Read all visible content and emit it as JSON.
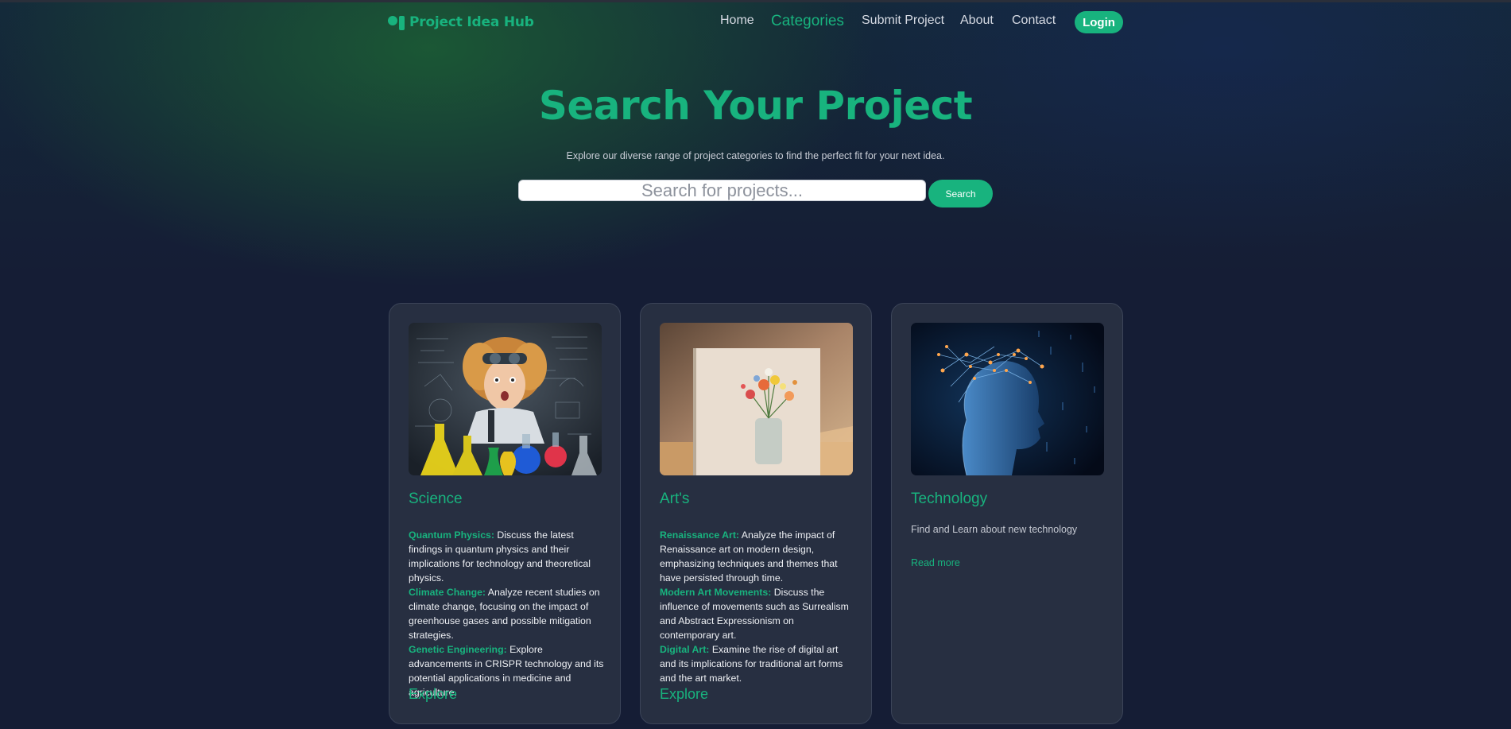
{
  "brand": {
    "name": "Project Idea Hub",
    "logo_icon": "project-hub-logo-icon"
  },
  "nav": {
    "items": [
      {
        "label": "Home",
        "active": false
      },
      {
        "label": "Categories",
        "active": true
      },
      {
        "label": "Submit Project",
        "active": false
      },
      {
        "label": "About",
        "active": false
      },
      {
        "label": "Contact",
        "active": false
      }
    ],
    "login_label": "Login"
  },
  "hero": {
    "title": "Search Your Project",
    "subtitle": "Explore our diverse range of project categories to find the perfect fit for your next idea.",
    "search_placeholder": "Search for projects...",
    "search_button": "Search"
  },
  "cards": [
    {
      "title": "Science",
      "image": "science-kid-lab-image",
      "items": [
        {
          "term": "Quantum Physics:",
          "text": " Discuss the latest findings in quantum physics and their implications for technology and theoretical physics."
        },
        {
          "term": "Climate Change:",
          "text": " Analyze recent studies on climate change, focusing on the impact of greenhouse gases and possible mitigation strategies."
        },
        {
          "term": "Genetic Engineering:",
          "text": " Explore advancements in CRISPR technology and its potential applications in medicine and agriculture."
        }
      ],
      "link": "Explore"
    },
    {
      "title": "Art's",
      "image": "flower-vase-painting-image",
      "items": [
        {
          "term": "Renaissance Art:",
          "text": " Analyze the impact of Renaissance art on modern design, emphasizing techniques and themes that have persisted through time."
        },
        {
          "term": "Modern Art Movements:",
          "text": " Discuss the influence of movements such as Surrealism and Abstract Expressionism on contemporary art."
        },
        {
          "term": "Digital Art:",
          "text": " Examine the rise of digital art and its implications for traditional art forms and the art market."
        }
      ],
      "link": "Explore"
    },
    {
      "title": "Technology",
      "image": "ai-neural-head-image",
      "description": "Find and Learn about new technology",
      "link": "Read more"
    }
  ],
  "colors": {
    "accent": "#18b37e",
    "background": "#151d35",
    "card_background": "#272f41",
    "text": "#eef0f4"
  }
}
